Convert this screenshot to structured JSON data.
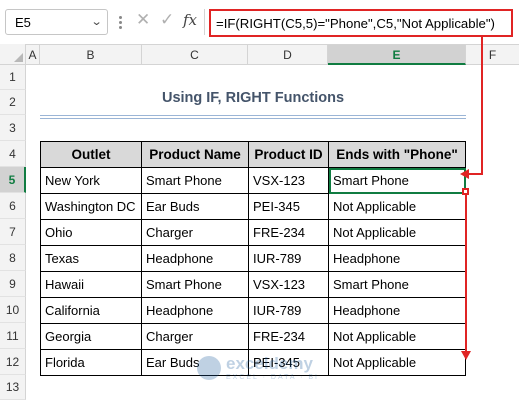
{
  "formula_bar": {
    "name_box": "E5",
    "cancel_icon": "✕",
    "enter_icon": "✓",
    "fx_label": "fx",
    "formula": "=IF(RIGHT(C5,5)=\"Phone\",C5,\"Not Applicable\")"
  },
  "columns": [
    "A",
    "B",
    "C",
    "D",
    "E",
    "F"
  ],
  "active_column": "E",
  "rows": [
    "1",
    "2",
    "3",
    "4",
    "5",
    "6",
    "7",
    "8",
    "9",
    "10",
    "11",
    "12",
    "13"
  ],
  "active_row": "5",
  "title": "Using IF, RIGHT Functions",
  "table": {
    "headers": [
      "Outlet",
      "Product Name",
      "Product ID",
      "Ends with \"Phone\""
    ],
    "rows": [
      [
        "New York",
        "Smart Phone",
        "VSX-123",
        "Smart Phone"
      ],
      [
        "Washington DC",
        "Ear Buds",
        "PEI-345",
        "Not Applicable"
      ],
      [
        "Ohio",
        "Charger",
        "FRE-234",
        "Not Applicable"
      ],
      [
        "Texas",
        "Headphone",
        "IUR-789",
        "Headphone"
      ],
      [
        "Hawaii",
        "Smart Phone",
        "VSX-123",
        "Smart Phone"
      ],
      [
        "California",
        "Headphone",
        "IUR-789",
        "Headphone"
      ],
      [
        "Georgia",
        "Charger",
        "FRE-234",
        "Not Applicable"
      ],
      [
        "Florida",
        "Ear Buds",
        "PEI-345",
        "Not Applicable"
      ]
    ]
  },
  "watermark": {
    "name": "exceldemy",
    "tagline": "EXCEL · DATA · BI"
  },
  "colors": {
    "accent_green": "#107c41",
    "arrow_red": "#e02424",
    "title_color": "#44546a",
    "header_fill": "#d9d9d9"
  }
}
